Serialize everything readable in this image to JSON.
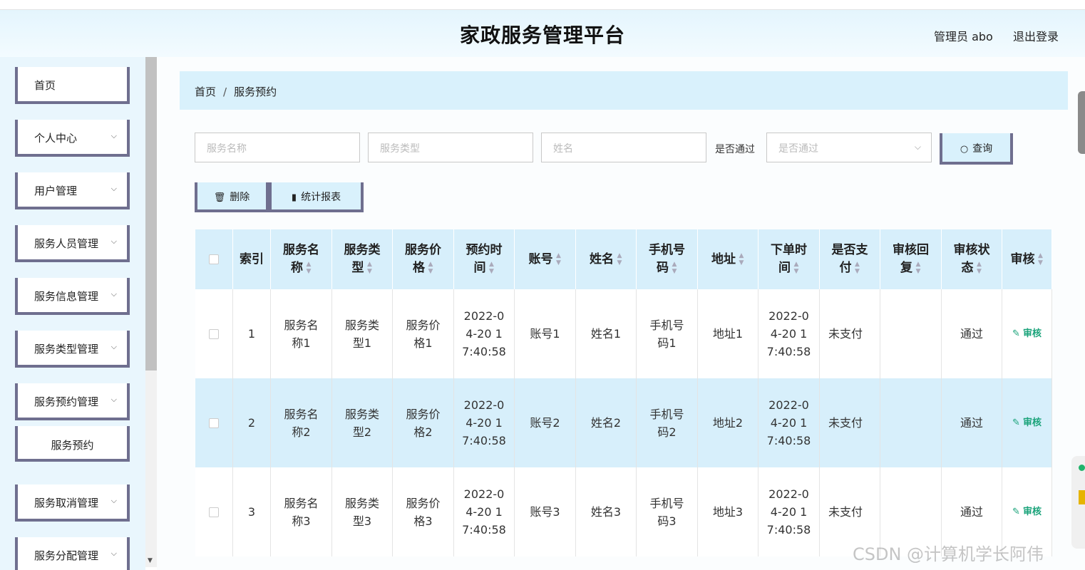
{
  "header": {
    "title": "家政服务管理平台",
    "user": "管理员 abo",
    "logout": "退出登录"
  },
  "sidebar": {
    "items": [
      {
        "label": "首页",
        "has_children": false
      },
      {
        "label": "个人中心",
        "has_children": true
      },
      {
        "label": "用户管理",
        "has_children": true
      },
      {
        "label": "服务人员管理",
        "has_children": true
      },
      {
        "label": "服务信息管理",
        "has_children": true
      },
      {
        "label": "服务类型管理",
        "has_children": true
      },
      {
        "label": "服务预约管理",
        "has_children": true,
        "expanded": true
      },
      {
        "label": "服务取消管理",
        "has_children": true
      },
      {
        "label": "服务分配管理",
        "has_children": true
      }
    ],
    "subitem": "服务预约"
  },
  "breadcrumb": {
    "home": "首页",
    "separator": "/",
    "current": "服务预约"
  },
  "filters": {
    "service_name_placeholder": "服务名称",
    "service_type_placeholder": "服务类型",
    "name_placeholder": "姓名",
    "approved_label": "是否通过",
    "approved_placeholder": "是否通过",
    "search_label": "查询"
  },
  "actions": {
    "delete_label": "删除",
    "report_label": "统计报表"
  },
  "table": {
    "columns": [
      "索引",
      "服务名称",
      "服务类型",
      "服务价格",
      "预约时间",
      "账号",
      "姓名",
      "手机号码",
      "地址",
      "下单时间",
      "是否支付",
      "审核回复",
      "审核状态",
      "审核"
    ],
    "rows": [
      {
        "index": "1",
        "service_name": "服务名称1",
        "service_type": "服务类型1",
        "price": "服务价格1",
        "appointment_time": "2022-04-20 17:40:58",
        "account": "账号1",
        "name": "姓名1",
        "phone": "手机号码1",
        "address": "地址1",
        "order_time": "2022-04-20 17:40:58",
        "paid": "未支付",
        "reply": "",
        "status": "通过",
        "audit": "审核"
      },
      {
        "index": "2",
        "service_name": "服务名称2",
        "service_type": "服务类型2",
        "price": "服务价格2",
        "appointment_time": "2022-04-20 17:40:58",
        "account": "账号2",
        "name": "姓名2",
        "phone": "手机号码2",
        "address": "地址2",
        "order_time": "2022-04-20 17:40:58",
        "paid": "未支付",
        "reply": "",
        "status": "通过",
        "audit": "审核"
      },
      {
        "index": "3",
        "service_name": "服务名称3",
        "service_type": "服务类型3",
        "price": "服务价格3",
        "appointment_time": "2022-04-20 17:40:58",
        "account": "账号3",
        "name": "姓名3",
        "phone": "手机号码3",
        "address": "地址3",
        "order_time": "2022-04-20 17:40:58",
        "paid": "未支付",
        "reply": "",
        "status": "通过",
        "audit": "审核"
      }
    ]
  },
  "watermark": "CSDN @计算机学长阿伟",
  "colors": {
    "accent_light_blue": "#d9f1fc",
    "border_purple_gray": "#6f6f8f",
    "row_alt": "#d7effb",
    "audit_green": "#1aa37a"
  }
}
